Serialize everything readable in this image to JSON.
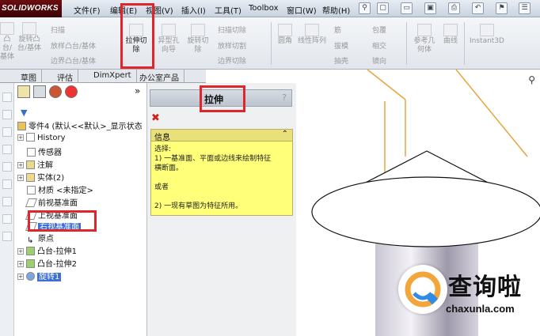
{
  "app": {
    "logo": "SOLIDWORKS"
  },
  "menubar": {
    "items": [
      "文件(F)",
      "编辑(E)",
      "视图(V)",
      "插入(I)",
      "工具(T)",
      "Toolbox",
      "窗口(W)",
      "帮助(H)"
    ]
  },
  "ribbon": {
    "extrude_boss": "凸台/基体",
    "revolve_boss": "旋转凸台/基体",
    "sweep": "扫描",
    "loft_boss": "放样凸台/基体",
    "boundary_boss": "边界凸台/基体",
    "extruded_cut": "拉伸切除",
    "hole_wizard": "异型孔向导",
    "revolved_cut": "旋转切除",
    "swept_cut": "扫描切除",
    "lofted_cut": "放样切割",
    "boundary_cut": "边界切除",
    "fillet": "圆角",
    "linear_pattern": "线性阵列",
    "rib": "筋",
    "draft": "拔模",
    "shell": "抽壳",
    "wrap": "包覆",
    "intersect": "相交",
    "mirror": "镜向",
    "ref_geometry": "参考几何体",
    "curves": "曲线",
    "instant3d": "Instant3D"
  },
  "tabs": [
    "草图",
    "评估",
    "DimXpert",
    "办公室产品"
  ],
  "tree": {
    "part": "零件4 (默认<<默认>_显示状态",
    "items": [
      {
        "label": "History"
      },
      {
        "label": "传感器"
      },
      {
        "label": "注解"
      },
      {
        "label": "实体(2)"
      },
      {
        "label": "材质 <未指定>"
      },
      {
        "label": "前视基准面"
      },
      {
        "label": "上视基准面"
      },
      {
        "label": "右视基准面"
      },
      {
        "label": "原点"
      },
      {
        "label": "凸台-拉伸1"
      },
      {
        "label": "凸台-拉伸2"
      },
      {
        "label": "旋转1"
      }
    ]
  },
  "property_manager": {
    "title": "拉伸",
    "help": "?",
    "info_header": "信息",
    "info_lines": [
      "选择:",
      "1) 一基准面、平面或边线来绘制特征",
      "横断面。",
      "",
      "或者",
      "",
      "2) 一现有草图为特征所用。"
    ]
  },
  "watermark": {
    "text": "查询啦",
    "url": "chaxunla.com"
  },
  "colors": {
    "highlight": "#e0262a",
    "selection": "#3e6fd6",
    "info_bg": "#ffff7a"
  }
}
